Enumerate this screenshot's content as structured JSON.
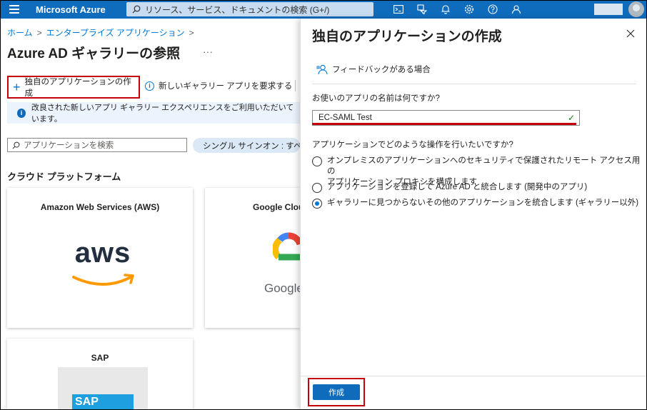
{
  "topbar": {
    "brand": "Microsoft Azure",
    "search_placeholder": "リソース、サービス、ドキュメントの検索 (G+/)",
    "icons": [
      "cloud-shell-icon",
      "directory-filter-icon",
      "notifications-icon",
      "settings-icon",
      "help-icon",
      "feedback-icon"
    ]
  },
  "breadcrumb": {
    "items": [
      "ホーム",
      "エンタープライズ アプリケーション"
    ],
    "separator": ">"
  },
  "page": {
    "title": "Azure AD ギャラリーの参照",
    "more": "···"
  },
  "toolbar": {
    "create_own_label": "独自のアプリケーションの作成",
    "request_app_label": "新しいギャラリー アプリを要求する"
  },
  "notice": {
    "text": "改良された新しいアプリ ギャラリー エクスペリエンスをご利用いただいています。"
  },
  "filters": {
    "search_placeholder": "アプリケーションを検索",
    "sso_pill": "シングル サインオン : すべて"
  },
  "section": {
    "title": "クラウド プラットフォーム"
  },
  "cards": [
    {
      "title": "Amazon Web Services (AWS)",
      "logo_text": "aws"
    },
    {
      "title": "Google Cloud",
      "logo_text": "Google"
    },
    {
      "title": "SAP",
      "logo_text": "SAP"
    }
  ],
  "panel": {
    "title": "独自のアプリケーションの作成",
    "feedback_label": "フィードバックがある場合",
    "name_question": "お使いのアプリの名前は何ですか?",
    "name_value": "EC-SAML Test",
    "action_question": "アプリケーションでどのような操作を行いたいですか?",
    "options": [
      {
        "label_line1": "オンプレミスのアプリケーションへのセキュリティで保護されたリモート アクセス用の",
        "label_line2": "アプリケーション プロキシを構成します",
        "selected": false
      },
      {
        "label_line1": "アプリケーションを登録して Azure AD と統合します (開発中のアプリ)",
        "label_line2": "",
        "selected": false
      },
      {
        "label_line1": "ギャラリーに見つからないその他のアプリケーションを統合します (ギャラリー以外)",
        "label_line2": "",
        "selected": true
      }
    ],
    "create_button": "作成"
  },
  "colors": {
    "azure_blue": "#0f6cbd",
    "highlight_red": "#c5000c",
    "link_blue": "#0078d4"
  }
}
